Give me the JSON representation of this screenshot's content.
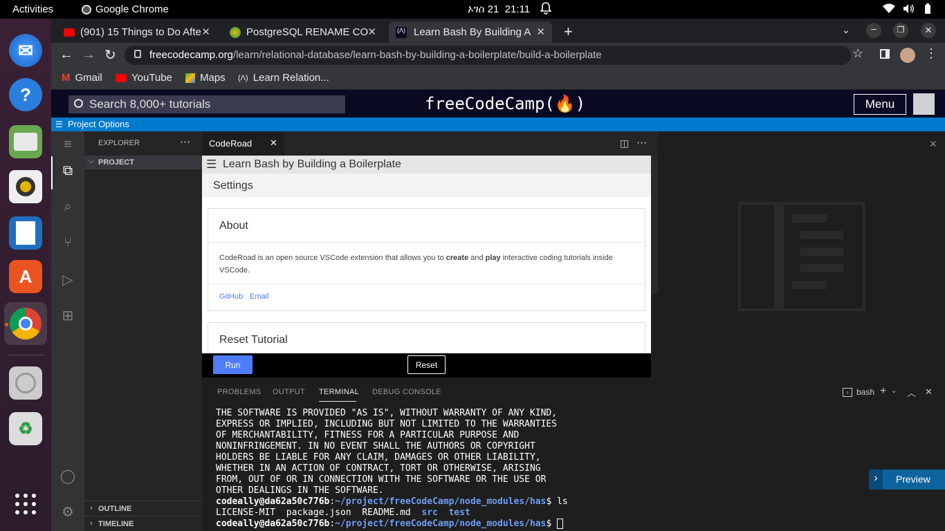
{
  "system_bar": {
    "activities": "Activities",
    "app_name": "Google Chrome",
    "date": "ኦገስ 21",
    "time": "21:11"
  },
  "dock": {
    "icons": [
      "thunderbird-icon",
      "help-icon",
      "files-icon",
      "rhythmbox-icon",
      "writer-icon",
      "app-center-icon",
      "chrome-icon",
      "disc-icon",
      "trash-icon",
      "apps-grid-icon"
    ]
  },
  "browser": {
    "tabs": [
      {
        "label": "(901) 15 Things to Do Afte",
        "icon": "youtube-icon"
      },
      {
        "label": "PostgreSQL RENAME CO",
        "icon": "postgres-icon"
      },
      {
        "label": "Learn Bash By Building A",
        "icon": "fcc-icon",
        "active": true
      }
    ],
    "url_domain": "freecodecamp.org",
    "url_path": "/learn/relational-database/learn-bash-by-building-a-boilerplate/build-a-boilerplate",
    "bookmarks": [
      "Gmail",
      "YouTube",
      "Maps",
      "Learn Relation..."
    ]
  },
  "fcc": {
    "search_placeholder": "Search 8,000+ tutorials",
    "logo": "freeCodeCamp(🔥)",
    "logo_text": "freeCodeCamp",
    "menu": "Menu",
    "project_options": "Project Options"
  },
  "vscode": {
    "explorer_title": "EXPLORER",
    "project_label": "PROJECT",
    "outline": "OUTLINE",
    "timeline": "TIMELINE",
    "editor_tab": "CodeRoad",
    "coderoad": {
      "header": "Learn Bash by Building a Boilerplate",
      "settings": "Settings",
      "about_title": "About",
      "about_text_1": "CodeRoad is an open source VSCode extension that allows you to ",
      "about_bold_1": "create",
      "about_text_2": " and ",
      "about_bold_2": "play",
      "about_text_3": " interactive coding tutorials inside VSCode.",
      "link_github": "GitHub",
      "link_email": "Email",
      "reset_title": "Reset Tutorial",
      "run_button": "Run",
      "reset_button": "Reset"
    },
    "panel_tabs": [
      "PROBLEMS",
      "OUTPUT",
      "TERMINAL",
      "DEBUG CONSOLE"
    ],
    "active_panel_tab": "TERMINAL",
    "terminal_shell": "bash",
    "terminal_lines": [
      "THE SOFTWARE IS PROVIDED \"AS IS\", WITHOUT WARRANTY OF ANY KIND,",
      "EXPRESS OR IMPLIED, INCLUDING BUT NOT LIMITED TO THE WARRANTIES",
      "OF MERCHANTABILITY, FITNESS FOR A PARTICULAR PURPOSE AND",
      "NONINFRINGEMENT. IN NO EVENT SHALL THE AUTHORS OR COPYRIGHT",
      "HOLDERS BE LIABLE FOR ANY CLAIM, DAMAGES OR OTHER LIABILITY,",
      "WHETHER IN AN ACTION OF CONTRACT, TORT OR OTHERWISE, ARISING",
      "FROM, OUT OF OR IN CONNECTION WITH THE SOFTWARE OR THE USE OR",
      "OTHER DEALINGS IN THE SOFTWARE."
    ],
    "prompt_user": "codeally@da62a50c776b",
    "prompt_path": "~/project/freeCodeCamp/node_modules/has",
    "command": "ls",
    "ls_files": "LICENSE-MIT  package.json  README.md",
    "ls_dirs": [
      "src",
      "test"
    ],
    "preview_button": "Preview"
  },
  "colors": {
    "fcc_nav": "#0a0a23",
    "vscode_accent": "#007acc",
    "run_button": "#4f7cff"
  }
}
